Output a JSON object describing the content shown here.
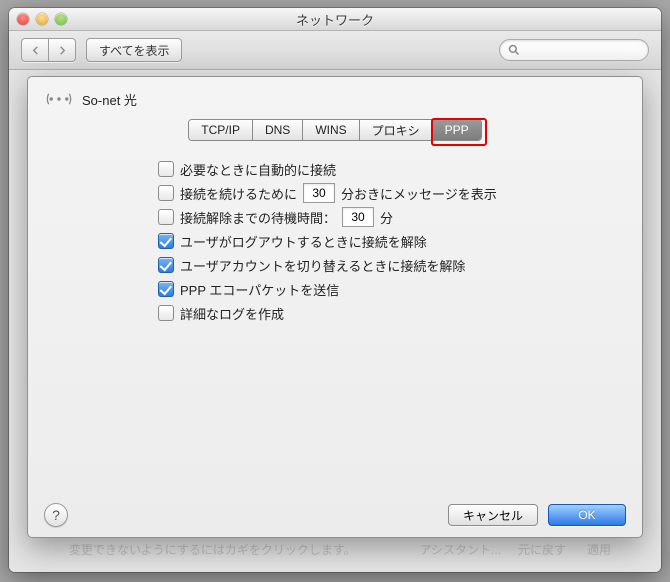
{
  "window": {
    "title": "ネットワーク"
  },
  "toolbar": {
    "show_all": "すべてを表示",
    "search_placeholder": ""
  },
  "connection": {
    "name": "So-net 光"
  },
  "tabs": [
    "TCP/IP",
    "DNS",
    "WINS",
    "プロキシ",
    "PPP"
  ],
  "active_tab_index": 4,
  "options": {
    "auto_connect": {
      "checked": false,
      "label": "必要なときに自動的に接続"
    },
    "keepalive": {
      "checked": false,
      "pre": "接続を続けるために",
      "value": "30",
      "post": "分おきにメッセージを表示"
    },
    "idle_disconnect": {
      "checked": false,
      "pre": "接続解除までの待機時間：",
      "value": "30",
      "post": "分"
    },
    "logout_disconnect": {
      "checked": true,
      "label": "ユーザがログアウトするときに接続を解除"
    },
    "switch_disconnect": {
      "checked": true,
      "label": "ユーザアカウントを切り替えるときに接続を解除"
    },
    "ppp_echo": {
      "checked": true,
      "label": "PPP エコーパケットを送信"
    },
    "verbose_log": {
      "checked": false,
      "label": "詳細なログを作成"
    }
  },
  "buttons": {
    "cancel": "キャンセル",
    "ok": "OK",
    "help": "?"
  }
}
